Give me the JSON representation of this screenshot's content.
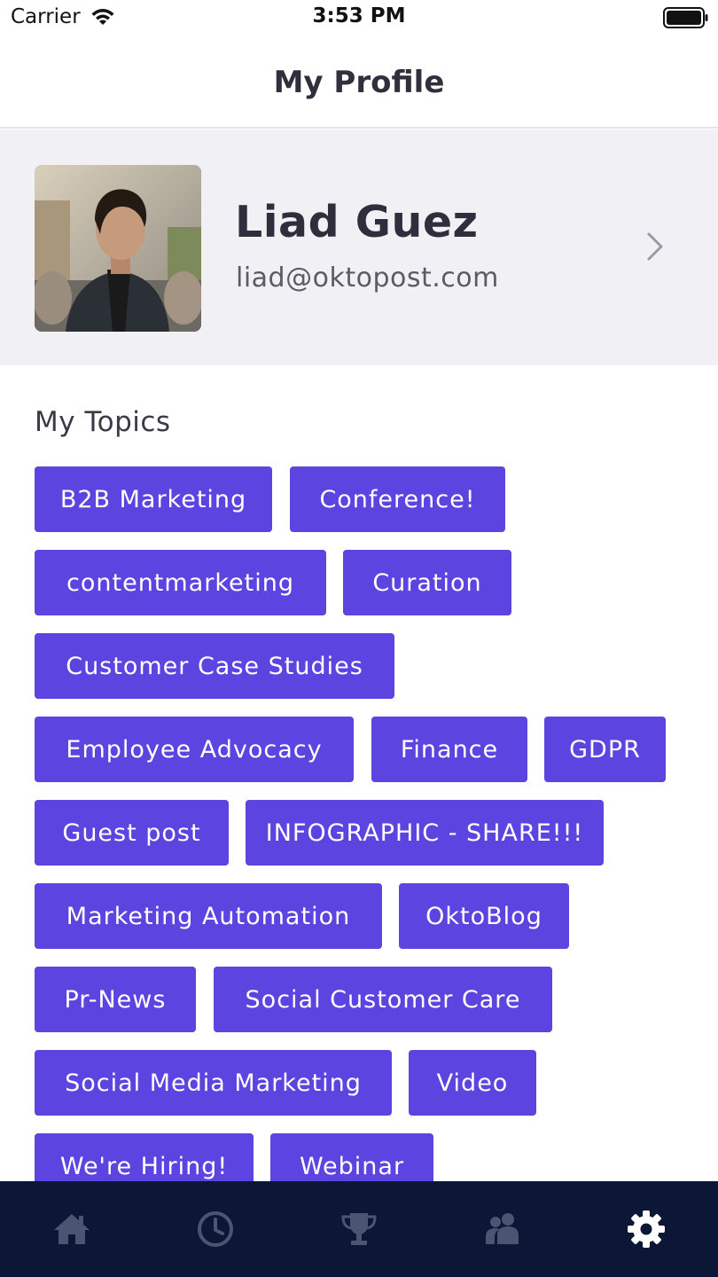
{
  "status_bar": {
    "carrier": "Carrier",
    "time": "3:53 PM"
  },
  "nav": {
    "title": "My Profile"
  },
  "profile": {
    "name": "Liad Guez",
    "email": "liad@oktopost.com"
  },
  "topics": {
    "title": "My Topics",
    "items": [
      "B2B Marketing",
      "Conference!",
      "contentmarketing",
      "Curation",
      "Customer Case Studies",
      "Employee Advocacy",
      "Finance",
      "GDPR",
      "Guest post",
      "INFOGRAPHIC - SHARE!!!",
      "Marketing Automation",
      "OktoBlog",
      "Pr-News",
      "Social Customer Care",
      "Social Media Marketing",
      "Video",
      "We're Hiring!",
      "Webinar"
    ]
  },
  "tab_bar": {
    "tabs": [
      {
        "icon": "home-icon",
        "active": false
      },
      {
        "icon": "clock-icon",
        "active": false
      },
      {
        "icon": "trophy-icon",
        "active": false
      },
      {
        "icon": "people-icon",
        "active": false
      },
      {
        "icon": "gear-icon",
        "active": true
      }
    ]
  },
  "colors": {
    "accent": "#5b44e0",
    "tab_bar": "#0c1636",
    "tab_inactive": "#4a5571",
    "tab_active": "#ffffff"
  }
}
